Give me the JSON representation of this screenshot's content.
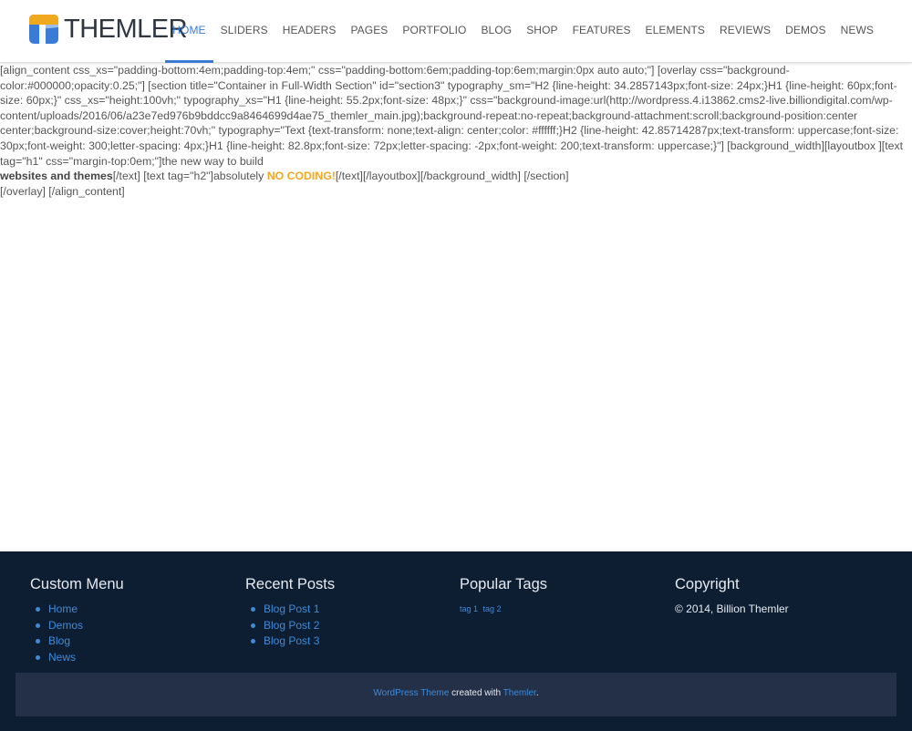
{
  "header": {
    "logo_text": "THEMLER",
    "nav": [
      {
        "label": "HOME",
        "active": true
      },
      {
        "label": "SLIDERS"
      },
      {
        "label": "HEADERS"
      },
      {
        "label": "PAGES"
      },
      {
        "label": "PORTFOLIO"
      },
      {
        "label": "BLOG"
      },
      {
        "label": "SHOP"
      },
      {
        "label": "FEATURES"
      },
      {
        "label": "ELEMENTS"
      },
      {
        "label": "REVIEWS"
      },
      {
        "label": "DEMOS"
      },
      {
        "label": "NEWS"
      }
    ],
    "colors": {
      "accent": "#3a7bd5",
      "logo_orange": "#f0a81e",
      "logo_blue": "#3a7bd5"
    }
  },
  "content": {
    "line1": "[align_content css_xs=\"padding-bottom:4em;padding-top:4em;\" css=\"padding-bottom:6em;padding-top:6em;margin:0px auto auto;\"] [overlay css=\"background-color:#000000;opacity:0.25;\"] [section title=\"Container in Full-Width Section\" id=\"section3\" typography_sm=\"H2 {line-height: 34.2857143px;font-size: 24px;}H1 {line-height: 60px;font-size: 60px;}\" css_xs=\"height:100vh;\" typography_xs=\"H1 {line-height: 55.2px;font-size: 48px;}\" css=\"background-image:url(http://wordpress.4.i13862.cms2-live.billiondigital.com/wp-content/uploads/2016/06/a23e7ed976b9bddcc9a8464699d4ae75_themler_main.jpg);background-repeat:no-repeat;background-attachment:scroll;background-position:center center;background-size:cover;height:70vh;\" typography=\"Text {text-transform: none;text-align: center;color: #ffffff;}H2 {line-height: 42.85714287px;text-transform: uppercase;font-size: 30px;font-weight: 300;letter-spacing: 4px;}H1 {line-height: 82.8px;font-size: 72px;letter-spacing: -2px;font-weight: 200;text-transform: uppercase;}\"] [background_width][layoutbox ][text tag=\"h1\" css=\"margin-top:0em;\"]the new way to build",
    "line2_bold": "websites and themes",
    "line2_mid": "[/text] [text tag=\"h2\"]absolutely ",
    "line2_orange": "NO CODING!",
    "line2_end": "[/text][/layoutbox][/background_width] [/section]",
    "line3": "[/overlay] [/align_content]"
  },
  "footer": {
    "custom_menu": {
      "title": "Custom Menu",
      "items": [
        "Home",
        "Demos",
        "Blog",
        "News"
      ]
    },
    "recent_posts": {
      "title": "Recent Posts",
      "items": [
        "Blog Post 1",
        "Blog Post 2",
        "Blog Post 3"
      ]
    },
    "popular_tags": {
      "title": "Popular Tags",
      "tags": [
        "tag 1",
        "tag 2"
      ]
    },
    "copyright": {
      "title": "Copyright",
      "text": "© 2014, Billion Themler"
    },
    "credit": {
      "link1": "WordPress Theme",
      "middle": " created with ",
      "link2": "Themler",
      "end": "."
    },
    "colors": {
      "background": "#0d1e33",
      "bar": "#233048",
      "link": "#3f8ad8"
    }
  }
}
